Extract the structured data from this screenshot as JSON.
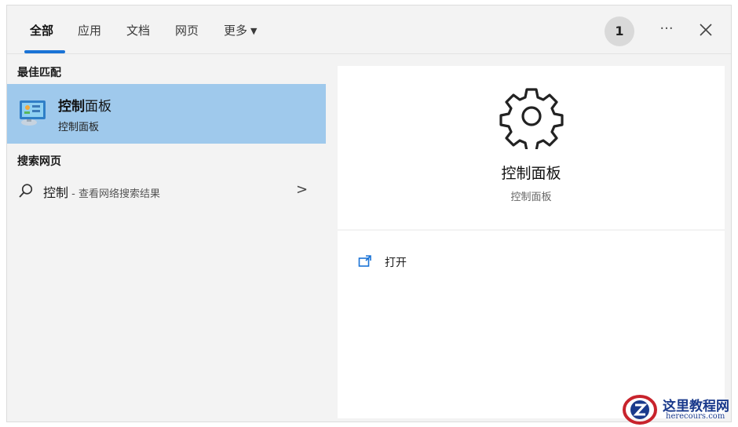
{
  "tabs": [
    {
      "label": "全部",
      "active": true
    },
    {
      "label": "应用",
      "active": false
    },
    {
      "label": "文档",
      "active": false
    },
    {
      "label": "网页",
      "active": false
    },
    {
      "label": "更多",
      "active": false
    }
  ],
  "header": {
    "notification_count": "1",
    "more_icon": "ellipsis-icon",
    "close_icon": "close-icon"
  },
  "best_match": {
    "section_title": "最佳匹配",
    "title_bold": "控制",
    "title_rest": "面板",
    "subtitle": "控制面板",
    "icon": "control-panel-icon"
  },
  "web_search": {
    "section_title": "搜索网页",
    "query": "控制",
    "hint": " - 查看网络搜索结果"
  },
  "preview": {
    "icon": "gear-icon",
    "title": "控制面板",
    "subtitle": "控制面板"
  },
  "actions": [
    {
      "label": "打开",
      "icon": "open-icon"
    }
  ],
  "watermark": {
    "name": "这里教程网",
    "url": "herecours.com"
  },
  "colors": {
    "selected_bg": "#9fc9ec",
    "accent": "#1a73d6",
    "pane_bg": "#f3f3f3"
  }
}
